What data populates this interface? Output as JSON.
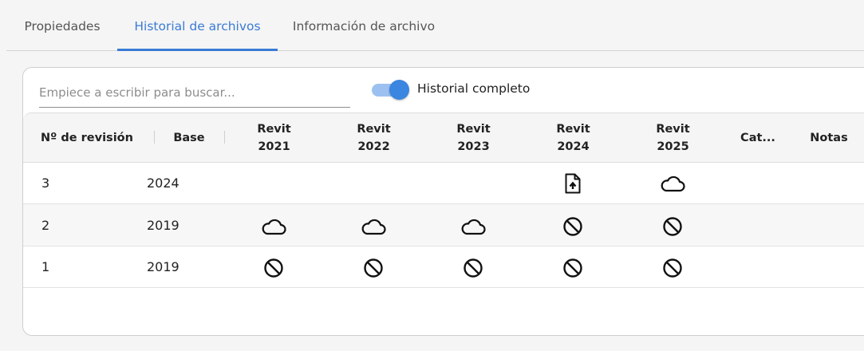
{
  "tabs": [
    {
      "label": "Propiedades"
    },
    {
      "label": "Historial de archivos"
    },
    {
      "label": "Información de archivo"
    }
  ],
  "search": {
    "placeholder": "Empiece a escribir para buscar..."
  },
  "toggle": {
    "label": "Historial completo",
    "on": true
  },
  "colors": {
    "accent": "#3a7bd5",
    "toggle_track": "#9cc1f0"
  },
  "table": {
    "columns": {
      "revision": "Nº de revisión",
      "base": "Base",
      "r2021": [
        "Revit",
        "2021"
      ],
      "r2022": [
        "Revit",
        "2022"
      ],
      "r2023": [
        "Revit",
        "2023"
      ],
      "r2024": [
        "Revit",
        "2024"
      ],
      "r2025": [
        "Revit",
        "2025"
      ],
      "cat": "Cat...",
      "notas": "Notas"
    },
    "rows": [
      {
        "revision": "3",
        "base": "2024",
        "statuses": [
          "",
          "",
          "",
          "file-upload-icon",
          "cloud-icon"
        ]
      },
      {
        "revision": "2",
        "base": "2019",
        "statuses": [
          "cloud-icon",
          "cloud-icon",
          "cloud-icon",
          "block-icon",
          "block-icon"
        ]
      },
      {
        "revision": "1",
        "base": "2019",
        "statuses": [
          "block-icon",
          "block-icon",
          "block-icon",
          "block-icon",
          "block-icon"
        ]
      }
    ]
  }
}
